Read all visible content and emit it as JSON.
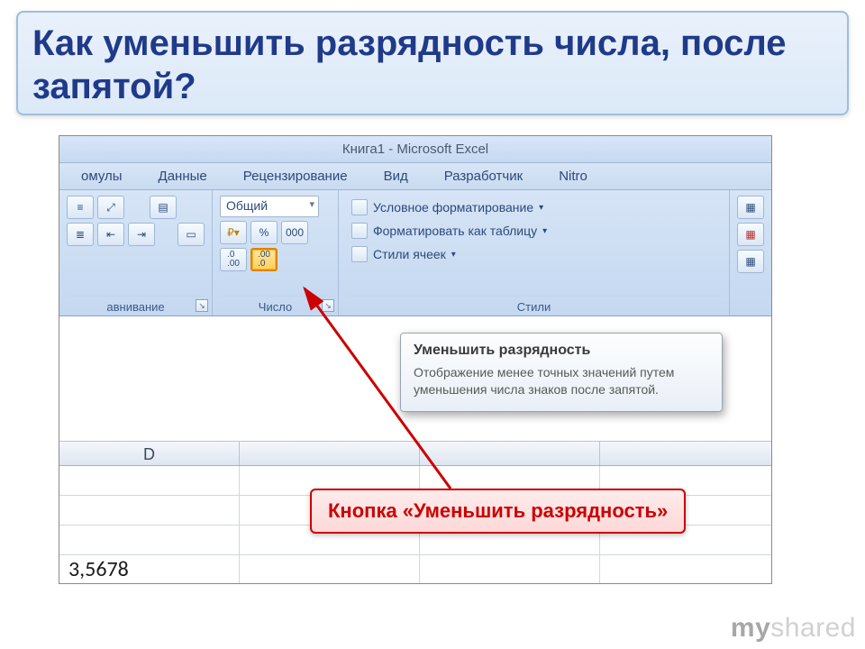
{
  "slide": {
    "title": "Как уменьшить разрядность числа, после запятой?"
  },
  "excel": {
    "window_title": "Книга1 - Microsoft Excel",
    "tabs": [
      "омулы",
      "Данные",
      "Рецензирование",
      "Вид",
      "Разработчик",
      "Nitro"
    ],
    "groups": {
      "alignment_label": "авнивание",
      "number_label": "Число",
      "styles_label": "Стили",
      "format_combo": "Общий",
      "percent_button": "%",
      "thousands_button": "000",
      "cond_format": "Условное форматирование",
      "format_as_table": "Форматировать как таблицу",
      "cell_styles": "Стили ячеек"
    },
    "tooltip": {
      "title": "Уменьшить разрядность",
      "body": "Отображение менее точных значений путем уменьшения числа знаков после запятой."
    },
    "column_header": "D",
    "cell_value": "3,5678"
  },
  "callout": {
    "label": "Кнопка «Уменьшить разрядность»"
  },
  "watermark": {
    "brand": "my",
    "rest": "shared"
  }
}
